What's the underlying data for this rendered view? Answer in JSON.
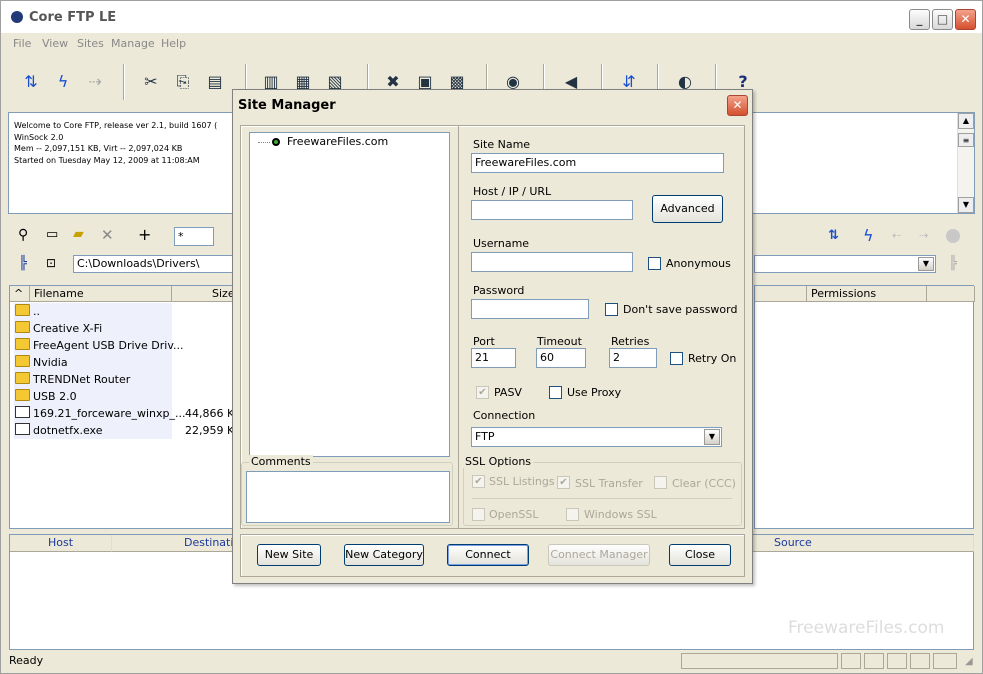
{
  "app": {
    "title": "Core FTP LE",
    "window_buttons": {
      "minimize": "_",
      "maximize": "□",
      "close": "✕"
    }
  },
  "menu": [
    "File",
    "View",
    "Sites",
    "Manage",
    "Help"
  ],
  "log": [
    "Welcome to Core FTP, release ver 2.1, build 1607 (",
    "WinSock 2.0",
    "Mem -- 2,097,151 KB, Virt -- 2,097,024 KB",
    "Started on Tuesday May 12, 2009 at 11:08:AM"
  ],
  "local": {
    "filter": "*",
    "path": "C:\\Downloads\\Drivers\\",
    "columns": {
      "sort": "^",
      "filename": "Filename",
      "size": "Size"
    },
    "files": [
      {
        "name": "..",
        "size": "",
        "type": "folder"
      },
      {
        "name": "Creative X-Fi",
        "size": "",
        "type": "folder"
      },
      {
        "name": "FreeAgent USB Drive Driv...",
        "size": "",
        "type": "folder"
      },
      {
        "name": "Nvidia",
        "size": "",
        "type": "folder"
      },
      {
        "name": "TRENDNet Router",
        "size": "",
        "type": "folder"
      },
      {
        "name": "USB 2.0",
        "size": "",
        "type": "folder"
      },
      {
        "name": "169.21_forceware_winxp_...",
        "size": "44,866 KB",
        "type": "file"
      },
      {
        "name": "dotnetfx.exe",
        "size": "22,959 KB",
        "type": "file"
      }
    ]
  },
  "remote": {
    "columns": {
      "permissions": "Permissions"
    }
  },
  "queue": {
    "columns": {
      "host": "Host",
      "destination": "Destination",
      "source": "Source"
    }
  },
  "status": {
    "text": "Ready"
  },
  "watermark": "FreewareFiles.com",
  "dialog": {
    "title": "Site Manager",
    "close": "✕",
    "tree": {
      "item": "FreewareFiles.com"
    },
    "site_name": {
      "label": "Site Name",
      "value": "FreewareFiles.com"
    },
    "host": {
      "label": "Host / IP / URL",
      "value": ""
    },
    "advanced": "Advanced",
    "username": {
      "label": "Username",
      "value": ""
    },
    "anonymous": "Anonymous",
    "password": {
      "label": "Password",
      "value": ""
    },
    "dont_save": "Don't save password",
    "port": {
      "label": "Port",
      "value": "21"
    },
    "timeout": {
      "label": "Timeout",
      "value": "60"
    },
    "retries": {
      "label": "Retries",
      "value": "2"
    },
    "retry_on": "Retry On",
    "pasv": "PASV",
    "use_proxy": "Use Proxy",
    "connection": {
      "label": "Connection",
      "value": "FTP"
    },
    "comments": "Comments",
    "ssl": {
      "group": "SSL Options",
      "listings": "SSL Listings",
      "transfer": "SSL Transfer",
      "clear": "Clear (CCC)",
      "openssl": "OpenSSL",
      "windows": "Windows SSL"
    },
    "buttons": {
      "new_site": "New Site",
      "new_category": "New Category",
      "connect": "Connect",
      "connect_manager": "Connect Manager",
      "close": "Close"
    }
  }
}
